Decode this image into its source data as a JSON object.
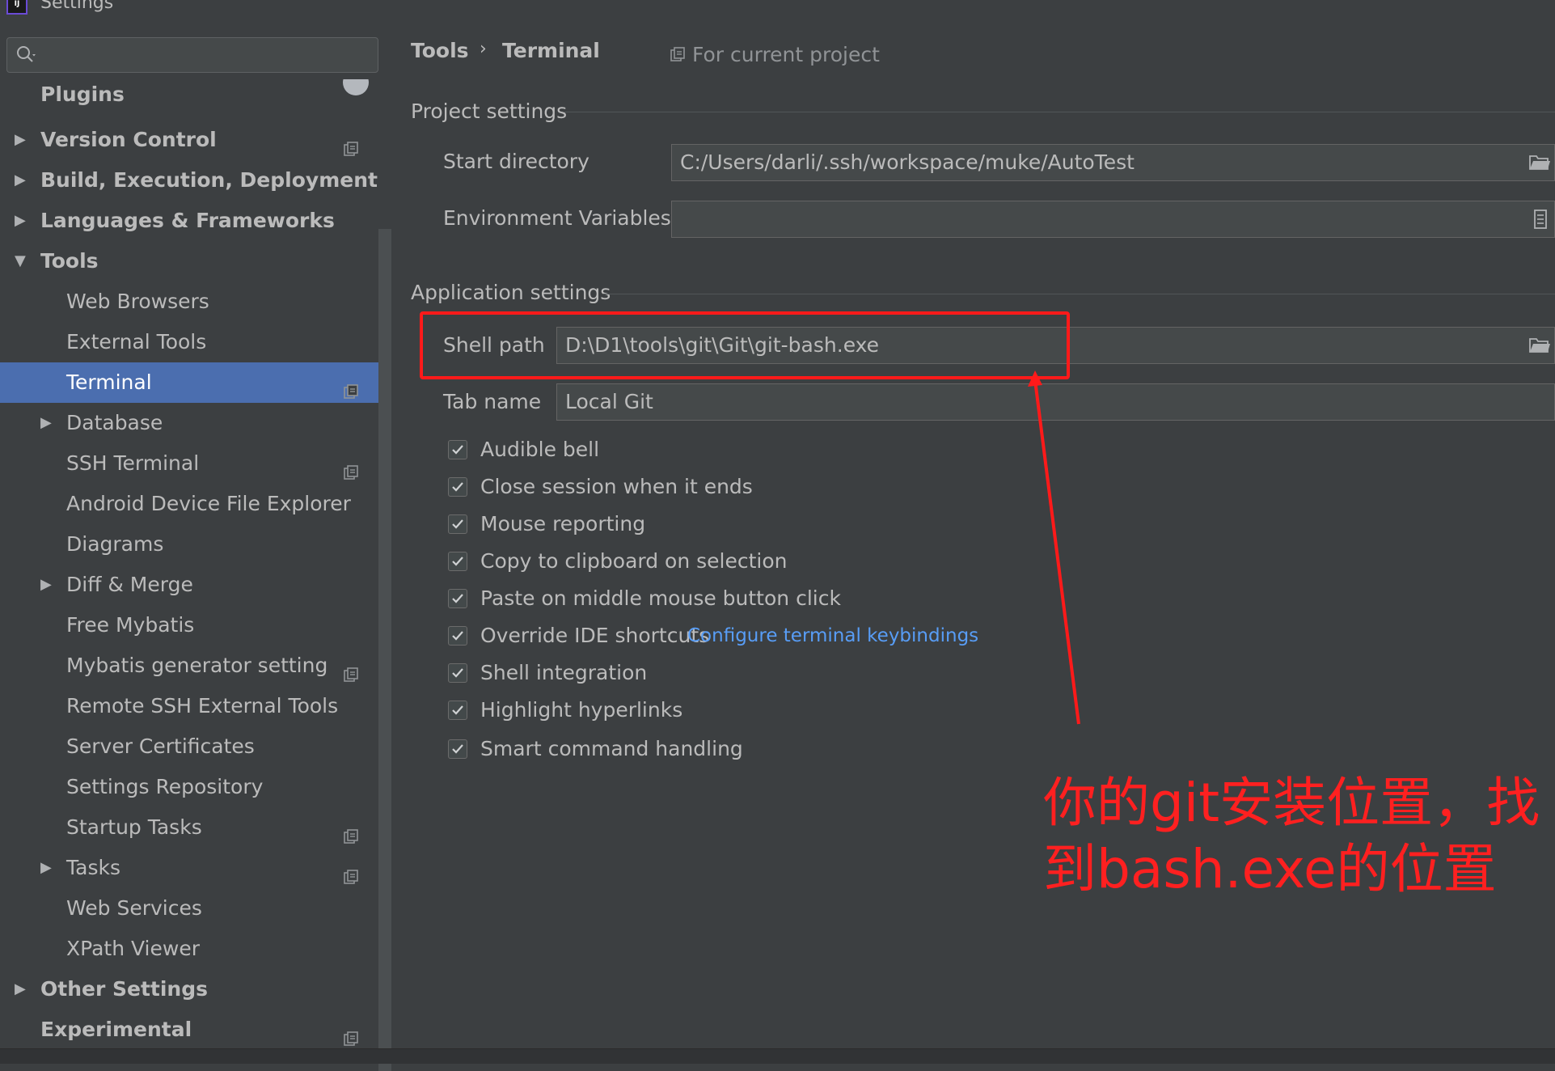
{
  "window": {
    "title": "Settings",
    "app_icon_text": "IJ"
  },
  "search": {
    "value": "",
    "placeholder": ""
  },
  "sidebar": {
    "items": [
      {
        "label": "Plugins",
        "bold": true,
        "level": 0,
        "arrow": "",
        "badge": "count"
      },
      {
        "label": "Version Control",
        "bold": true,
        "level": 0,
        "arrow": "right",
        "badge": "project"
      },
      {
        "label": "Build, Execution, Deployment",
        "bold": true,
        "level": 0,
        "arrow": "right",
        "badge": ""
      },
      {
        "label": "Languages & Frameworks",
        "bold": true,
        "level": 0,
        "arrow": "right",
        "badge": ""
      },
      {
        "label": "Tools",
        "bold": true,
        "level": 0,
        "arrow": "down",
        "badge": ""
      },
      {
        "label": "Web Browsers",
        "bold": false,
        "level": 1,
        "arrow": "",
        "badge": ""
      },
      {
        "label": "External Tools",
        "bold": false,
        "level": 1,
        "arrow": "",
        "badge": ""
      },
      {
        "label": "Terminal",
        "bold": false,
        "level": 1,
        "arrow": "",
        "badge": "project",
        "selected": true
      },
      {
        "label": "Database",
        "bold": false,
        "level": 1,
        "arrow": "right",
        "badge": ""
      },
      {
        "label": "SSH Terminal",
        "bold": false,
        "level": 1,
        "arrow": "",
        "badge": "project"
      },
      {
        "label": "Android Device File Explorer",
        "bold": false,
        "level": 1,
        "arrow": "",
        "badge": ""
      },
      {
        "label": "Diagrams",
        "bold": false,
        "level": 1,
        "arrow": "",
        "badge": ""
      },
      {
        "label": "Diff & Merge",
        "bold": false,
        "level": 1,
        "arrow": "right",
        "badge": ""
      },
      {
        "label": "Free Mybatis",
        "bold": false,
        "level": 1,
        "arrow": "",
        "badge": ""
      },
      {
        "label": "Mybatis generator setting",
        "bold": false,
        "level": 1,
        "arrow": "",
        "badge": "project"
      },
      {
        "label": "Remote SSH External Tools",
        "bold": false,
        "level": 1,
        "arrow": "",
        "badge": ""
      },
      {
        "label": "Server Certificates",
        "bold": false,
        "level": 1,
        "arrow": "",
        "badge": ""
      },
      {
        "label": "Settings Repository",
        "bold": false,
        "level": 1,
        "arrow": "",
        "badge": ""
      },
      {
        "label": "Startup Tasks",
        "bold": false,
        "level": 1,
        "arrow": "",
        "badge": "project"
      },
      {
        "label": "Tasks",
        "bold": false,
        "level": 1,
        "arrow": "right",
        "badge": "project"
      },
      {
        "label": "Web Services",
        "bold": false,
        "level": 1,
        "arrow": "",
        "badge": ""
      },
      {
        "label": "XPath Viewer",
        "bold": false,
        "level": 1,
        "arrow": "",
        "badge": ""
      },
      {
        "label": "Other Settings",
        "bold": true,
        "level": 0,
        "arrow": "right",
        "badge": ""
      },
      {
        "label": "Experimental",
        "bold": true,
        "level": 0,
        "arrow": "",
        "badge": "project"
      }
    ]
  },
  "breadcrumb": {
    "parent": "Tools",
    "separator": "›",
    "current": "Terminal",
    "scope": "For current project"
  },
  "project_settings": {
    "heading": "Project settings",
    "start_directory_label": "Start directory",
    "start_directory_value": "C:/Users/darli/.ssh/workspace/muke/AutoTest",
    "env_vars_label": "Environment Variables",
    "env_vars_value": ""
  },
  "app_settings": {
    "heading": "Application settings",
    "shell_path_label": "Shell path",
    "shell_path_value": "D:\\D1\\tools\\git\\Git\\git-bash.exe",
    "tab_name_label": "Tab name",
    "tab_name_value": "Local Git",
    "checkboxes": [
      {
        "label": "Audible bell",
        "checked": true
      },
      {
        "label": "Close session when it ends",
        "checked": true
      },
      {
        "label": "Mouse reporting",
        "checked": true
      },
      {
        "label": "Copy to clipboard on selection",
        "checked": true
      },
      {
        "label": "Paste on middle mouse button click",
        "checked": true
      },
      {
        "label": "Override IDE shortcuts",
        "checked": true
      },
      {
        "label": "Shell integration",
        "checked": true
      },
      {
        "label": "Highlight hyperlinks",
        "checked": true
      },
      {
        "label": "Smart command handling",
        "checked": true
      }
    ],
    "keybindings_link": "Configure terminal keybindings"
  },
  "annotation": {
    "text_line1": "你的git安装位置，找",
    "text_line2": "到bash.exe的位置",
    "color": "#ff2020"
  },
  "colors": {
    "background": "#3c3f41",
    "selection": "#4b6eaf",
    "link": "#589df6",
    "annotation_red": "#ff1a1a"
  }
}
